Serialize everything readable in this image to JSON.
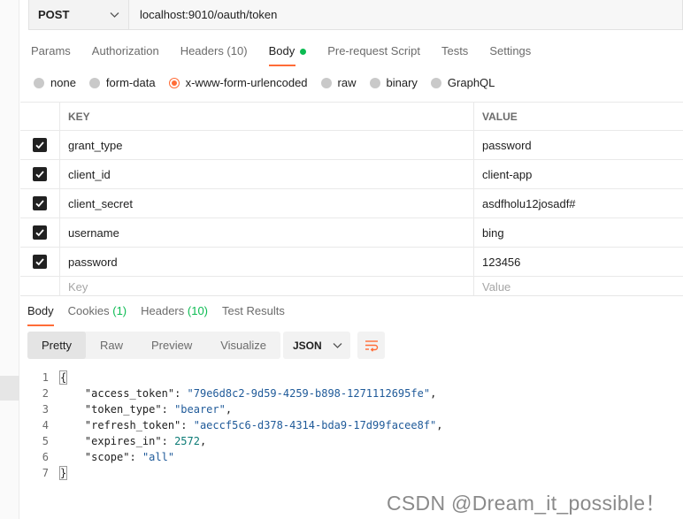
{
  "request": {
    "method": "POST",
    "url": "localhost:9010/oauth/token"
  },
  "request_tabs": [
    {
      "label": "Params",
      "count": ""
    },
    {
      "label": "Authorization",
      "count": ""
    },
    {
      "label": "Headers (10)",
      "count": ""
    },
    {
      "label": "Body",
      "count": ""
    },
    {
      "label": "Pre-request Script",
      "count": ""
    },
    {
      "label": "Tests",
      "count": ""
    },
    {
      "label": "Settings",
      "count": ""
    }
  ],
  "body_types": [
    "none",
    "form-data",
    "x-www-form-urlencoded",
    "raw",
    "binary",
    "GraphQL"
  ],
  "table": {
    "key_header": "KEY",
    "value_header": "VALUE",
    "rows": [
      {
        "key": "grant_type",
        "value": "password"
      },
      {
        "key": "client_id",
        "value": "client-app"
      },
      {
        "key": "client_secret",
        "value": "asdfholu12josadf#"
      },
      {
        "key": "username",
        "value": "bing"
      },
      {
        "key": "password",
        "value": "123456"
      }
    ],
    "key_placeholder": "Key",
    "value_placeholder": "Value"
  },
  "response_tabs": {
    "body": "Body",
    "cookies": "Cookies",
    "cookies_count": "(1)",
    "headers": "Headers",
    "headers_count": "(10)",
    "test_results": "Test Results"
  },
  "view_modes": [
    "Pretty",
    "Raw",
    "Preview",
    "Visualize"
  ],
  "format": "JSON",
  "code_lines": [
    {
      "n": "1"
    },
    {
      "n": "2",
      "key": "\"access_token\"",
      "val": "\"79e6d8c2-9d59-4259-b898-1271112695fe\""
    },
    {
      "n": "3",
      "key": "\"token_type\"",
      "val": "\"bearer\""
    },
    {
      "n": "4",
      "key": "\"refresh_token\"",
      "val": "\"aeccf5c6-d378-4314-bda9-17d99facee8f\""
    },
    {
      "n": "5",
      "key": "\"expires_in\"",
      "num": "2572"
    },
    {
      "n": "6",
      "key": "\"scope\"",
      "val": "\"all\""
    },
    {
      "n": "7"
    }
  ],
  "watermark": "CSDN @Dream_it_possible！"
}
